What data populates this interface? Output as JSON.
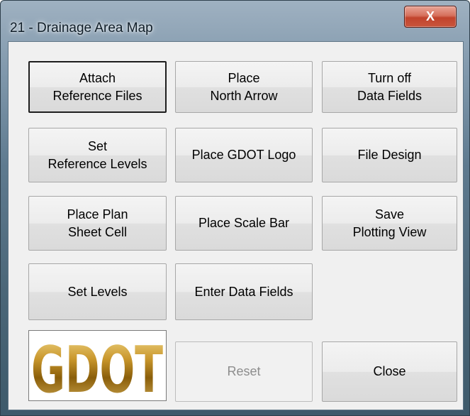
{
  "window": {
    "title": "21 - Drainage Area Map",
    "close_glyph": "X"
  },
  "buttons": {
    "attach_reference_files": "Attach\nReference Files",
    "place_north_arrow": "Place\nNorth Arrow",
    "turn_off_data_fields": "Turn off\nData Fields",
    "set_reference_levels": "Set\nReference Levels",
    "place_gdot_logo": "Place GDOT Logo",
    "file_design": "File Design",
    "place_plan_sheet_cell": "Place Plan\nSheet Cell",
    "place_scale_bar": "Place Scale Bar",
    "save_plotting_view": "Save\nPlotting View",
    "set_levels": "Set Levels",
    "enter_data_fields": "Enter Data Fields",
    "reset": "Reset",
    "close": "Close"
  },
  "logo": {
    "text": "GDOT",
    "colors": {
      "gold_light": "#e8c86a",
      "gold_dark": "#7a5406"
    }
  }
}
